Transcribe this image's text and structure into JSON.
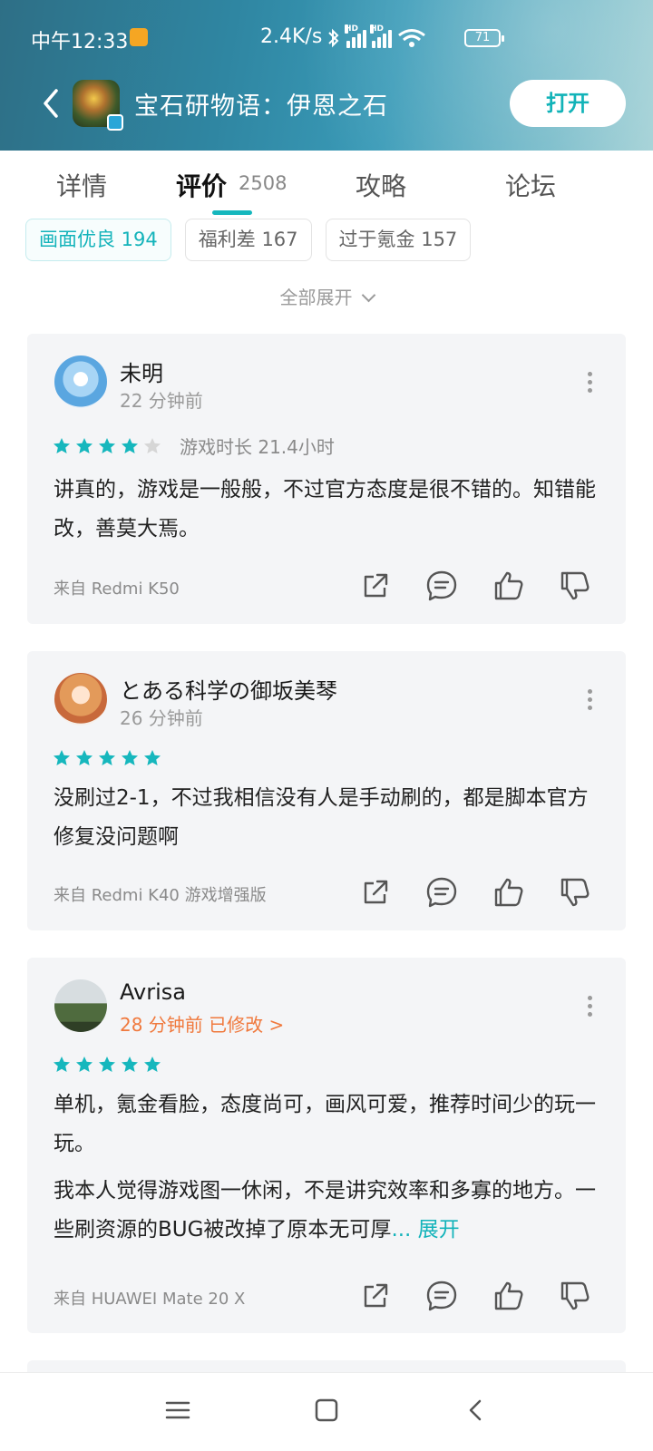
{
  "status_bar": {
    "time": "中午12:33",
    "net_speed": "2.4K/s",
    "sim1": "HD",
    "sim2": "HD",
    "battery": "71"
  },
  "header": {
    "app_title": "宝石研物语：伊恩之石",
    "open_label": "打开"
  },
  "tabs": [
    {
      "label": "详情"
    },
    {
      "label": "评价",
      "count": "2508"
    },
    {
      "label": "攻略"
    },
    {
      "label": "论坛"
    }
  ],
  "tags": [
    {
      "label": "画面优良 194"
    },
    {
      "label": "福利差 167"
    },
    {
      "label": "过于氪金 157"
    }
  ],
  "expand_all_label": "全部展开",
  "reviews": [
    {
      "username": "未明",
      "time": "22 分钟前",
      "rating": 4,
      "playtime": "游戏时长 21.4小时",
      "body": "讲真的，游戏是一般般，不过官方态度是很不错的。知错能改，善莫大焉。",
      "device": "来自 Redmi K50"
    },
    {
      "username": "とある科学の御坂美琴",
      "time": "26 分钟前",
      "rating": 5,
      "body": "没刷过2-1，不过我相信没有人是手动刷的，都是脚本官方修复没问题啊",
      "device": "来自 Redmi K40 游戏增强版"
    },
    {
      "username": "Avrisa",
      "time": "28 分钟前 已修改 >",
      "rating": 5,
      "body": "单机，氪金看脸，态度尚可，画风可爱，推荐时间少的玩一玩。",
      "body2": "我本人觉得游戏图一休闲，不是讲究效率和多寡的地方。一些刷资源的BUG被改掉了原本无可厚",
      "expand_label": "... 展开",
      "device": "来自 HUAWEI Mate 20 X"
    }
  ],
  "colors": {
    "accent": "#16b7bd",
    "star_on": "#16b7bd",
    "star_off": "#d6d6d6",
    "edited": "#f0793d"
  }
}
